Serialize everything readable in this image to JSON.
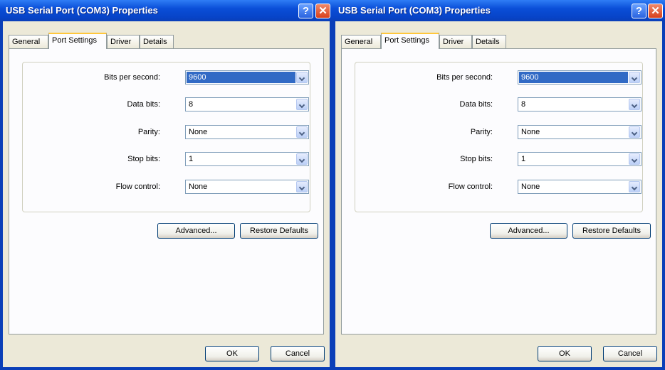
{
  "dialogs": [
    {
      "title": "USB Serial Port (COM3) Properties",
      "help_glyph": "?",
      "close_glyph": "✕",
      "tabs": [
        "General",
        "Port Settings",
        "Driver",
        "Details"
      ],
      "active_tab": "Port Settings",
      "settings": [
        {
          "label": "Bits per second:",
          "value": "9600",
          "selected": true
        },
        {
          "label": "Data bits:",
          "value": "8",
          "selected": false
        },
        {
          "label": "Parity:",
          "value": "None",
          "selected": false
        },
        {
          "label": "Stop bits:",
          "value": "1",
          "selected": false
        },
        {
          "label": "Flow control:",
          "value": "None",
          "selected": false
        }
      ],
      "advanced_label": "Advanced...",
      "restore_label": "Restore Defaults",
      "ok_label": "OK",
      "cancel_label": "Cancel"
    },
    {
      "title": "USB Serial Port (COM3) Properties",
      "help_glyph": "?",
      "close_glyph": "✕",
      "tabs": [
        "General",
        "Port Settings",
        "Driver",
        "Details"
      ],
      "active_tab": "Port Settings",
      "settings": [
        {
          "label": "Bits per second:",
          "value": "9600",
          "selected": true
        },
        {
          "label": "Data bits:",
          "value": "8",
          "selected": false
        },
        {
          "label": "Parity:",
          "value": "None",
          "selected": false
        },
        {
          "label": "Stop bits:",
          "value": "1",
          "selected": false
        },
        {
          "label": "Flow control:",
          "value": "None",
          "selected": false
        }
      ],
      "advanced_label": "Advanced...",
      "restore_label": "Restore Defaults",
      "ok_label": "OK",
      "cancel_label": "Cancel"
    }
  ]
}
